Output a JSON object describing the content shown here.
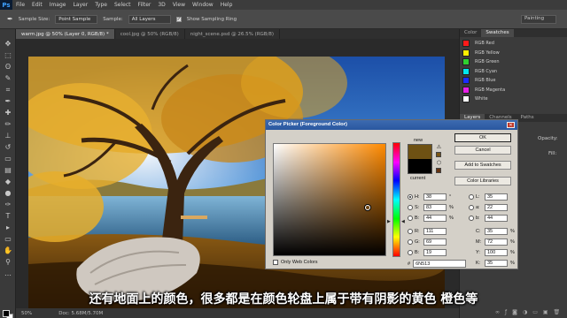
{
  "menubar": {
    "logo": "Ps",
    "items": [
      "File",
      "Edit",
      "Image",
      "Layer",
      "Type",
      "Select",
      "Filter",
      "3D",
      "View",
      "Window",
      "Help"
    ]
  },
  "options": {
    "sample_size_label": "Sample Size:",
    "sample_size_value": "Point Sample",
    "sample_label": "Sample:",
    "sample_value": "All Layers",
    "show_ring_label": "Show Sampling Ring",
    "workspace": "Painting"
  },
  "tabs": [
    {
      "label": "warm.jpg @ 50% (Layer 0, RGB/8) *",
      "active": true
    },
    {
      "label": "cool.jpg @ 50% (RGB/8)",
      "active": false
    },
    {
      "label": "night_scene.psd @ 26.5% (RGB/8)",
      "active": false
    }
  ],
  "statusbar": {
    "zoom": "50%",
    "doc": "Doc: 5.68M/5.70M"
  },
  "swatches_panel": {
    "tabs": [
      "Color",
      "Swatches"
    ],
    "items": [
      {
        "label": "RGB Red",
        "color": "#ff1a1a"
      },
      {
        "label": "RGB Yellow",
        "color": "#ffee00"
      },
      {
        "label": "RGB Green",
        "color": "#2fd12f"
      },
      {
        "label": "RGB Cyan",
        "color": "#00e8ee"
      },
      {
        "label": "RGB Blue",
        "color": "#1a2cff"
      },
      {
        "label": "RGB Magenta",
        "color": "#e81ee8"
      },
      {
        "label": "White",
        "color": "#ffffff"
      }
    ]
  },
  "layers_panel": {
    "tabs": [
      "Layers",
      "Channels",
      "Paths"
    ],
    "opacity_label": "Opacity:",
    "fill_label": "Fill:"
  },
  "color_picker": {
    "title": "Color Picker (Foreground Color)",
    "new_label": "new",
    "current_label": "current",
    "new_color": "#6e5113",
    "current_color": "#000000",
    "buttons": [
      "OK",
      "Cancel",
      "Add to Swatches",
      "Color Libraries"
    ],
    "only_web_colors": "Only Web Colors",
    "hsb": [
      {
        "name": "H:",
        "value": "38",
        "unit": "°",
        "selected": true
      },
      {
        "name": "S:",
        "value": "83",
        "unit": "%",
        "selected": false
      },
      {
        "name": "B:",
        "value": "44",
        "unit": "%",
        "selected": false
      }
    ],
    "rgb": [
      {
        "name": "R:",
        "value": "111"
      },
      {
        "name": "G:",
        "value": "69"
      },
      {
        "name": "B:",
        "value": "19"
      }
    ],
    "lab": [
      {
        "name": "L:",
        "value": "35"
      },
      {
        "name": "a:",
        "value": "22"
      },
      {
        "name": "b:",
        "value": "44"
      }
    ],
    "cmyk": [
      {
        "name": "C:",
        "value": "35",
        "unit": "%"
      },
      {
        "name": "M:",
        "value": "72",
        "unit": "%"
      },
      {
        "name": "Y:",
        "value": "100",
        "unit": "%"
      },
      {
        "name": "K:",
        "value": "35",
        "unit": "%"
      }
    ],
    "hex_prefix": "#",
    "hex": "6N513"
  },
  "subtitle": "还有地面上的颜色，很多都是在颜色轮盘上属于带有阴影的黄色 橙色等"
}
